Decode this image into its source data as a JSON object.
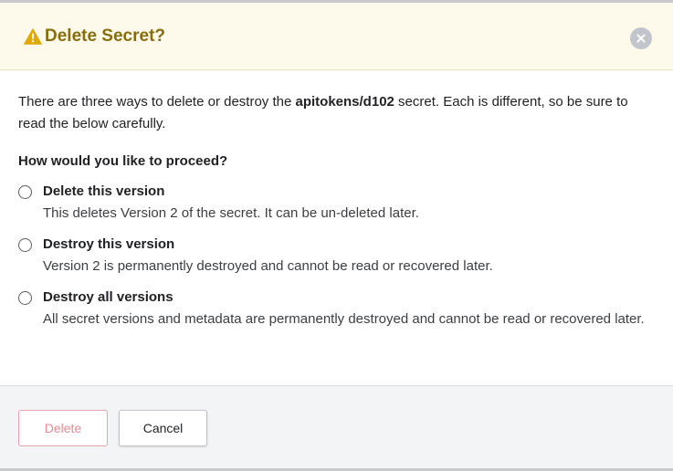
{
  "dialog": {
    "title": "Delete Secret?",
    "warning_icon": "warning-triangle-icon",
    "close_icon": "close-icon",
    "intro_before": "There are three ways to delete or destroy the ",
    "secret_path": "apitokens/d102",
    "intro_after": " secret. Each is different, so be sure to read the below carefully.",
    "question": "How would you like to proceed?",
    "options": [
      {
        "label": "Delete this version",
        "description": "This deletes Version 2 of the secret. It can be un-deleted later."
      },
      {
        "label": "Destroy this version",
        "description": "Version 2 is permanently destroyed and cannot be read or recovered later."
      },
      {
        "label": "Destroy all versions",
        "description": "All secret versions and metadata are permanently destroyed and cannot be read or recovered later."
      }
    ],
    "buttons": {
      "delete_label": "Delete",
      "cancel_label": "Cancel"
    }
  },
  "colors": {
    "header_background": "#fdfaeb",
    "title_color": "#8a6d0b",
    "warning_icon": "#e0a800",
    "delete_button_border": "#e8a3ae",
    "delete_button_text": "#e38a98",
    "footer_background": "#f3f4f6"
  }
}
